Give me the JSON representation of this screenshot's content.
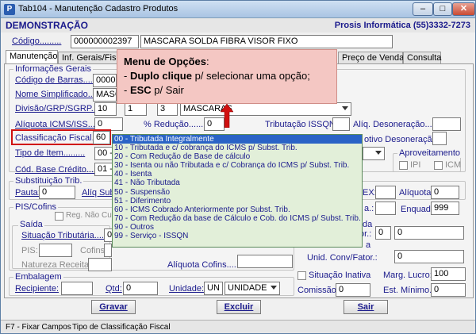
{
  "window": {
    "title": "Tab104 - Manutenção Cadastro Produtos",
    "app_icon": "P"
  },
  "header": {
    "company_mode": "DEMONSTRAÇÃO",
    "company_contact": "Prosis Informática (55)3332-7273"
  },
  "product": {
    "code_label": "Código.........",
    "code": "000000002397",
    "description": "MASCARA SOLDA FIBRA VISOR FIXO"
  },
  "tabs": [
    "Manutenção",
    "Inf. Gerais/Fiscais",
    "Preço de Venda",
    "Consulta"
  ],
  "tooltip": {
    "title": "Menu de Opções",
    "colon": ":",
    "line1_bold": "Duplo clique",
    "line1_rest": " p/ selecionar uma opção;",
    "line2_bold": "ESC",
    "line2_rest": " p/ Sair"
  },
  "general": {
    "section": "Informações Gerais",
    "barcode_label": "Código de Barras......",
    "barcode_value": "00000",
    "short_name_label": "Nome Simplificado.....",
    "short_name_value": "MASC",
    "division_label": "Divisão/GRP/SGRP..:",
    "division": "10",
    "group": "1",
    "subgroup": "3",
    "subgroup_name": "MASCARAS",
    "icms_label": "Alíquota ICMS/ISS......",
    "icms_value": "0",
    "reduction_label": "% Redução.........",
    "reduction_value": "0",
    "issqn_label": "Tributação ISSQN:",
    "desoneracao_label": "Alíq. Desoneração...:",
    "class_label": "Classificação Fiscal..:",
    "class_value": "60",
    "motivo_label": "otivo Desoneração:",
    "item_type_label": "Tipo de Item.........",
    "item_type_value": "00 -",
    "base_code_label": "Cód. Base Crédito......",
    "base_code_value": "01 -",
    "aproveitamento_label": "Aproveitamento",
    "ipi_label": "IPI",
    "icm_label": "ICM"
  },
  "subst": {
    "section": "Substituição Trib.",
    "pauta_label": "Pauta:",
    "pauta_value": "0",
    "aliq_sub_label": "Alíq Sub",
    "ex_label": "EX:",
    "aliquota_label": "Alíquota:",
    "aliquota_value": "0",
    "a_label": "a.:",
    "enquad_label": "Enquad.:",
    "enquad_value": "999"
  },
  "pis": {
    "section": "PIS/Cofins",
    "reg_label": "Reg. Não Cumula",
    "saida": "Saída",
    "sit_label": "Situação Tributária.......",
    "sit_value": "01",
    "pis_label": "PIS:",
    "cofins_label": "Cofins:",
    "natureza_label": "Natureza Receita........",
    "aliq_cofins_label": "Alíquota Cofins.........",
    "or_label": "or.:",
    "or_value": "0",
    "da_label": "da",
    "unid_label": "Unid. Conv/Fator.:",
    "unid_value": "0",
    "a2_label": "a",
    "or2_value": "0"
  },
  "embalagem": {
    "section": "Embalagem",
    "recipiente_label": "Recipiente:",
    "qtd_label": "Qtd:",
    "qtd_value": "0",
    "unidade_label": "Unidade:",
    "unidade_code": "UN",
    "unidade_name": "UNIDADE",
    "situacao_label": "Situação Inativa",
    "marg_label": "Marg. Lucro:",
    "marg_value": "100",
    "comissao_label": "Comissão:",
    "comissao_value": "0",
    "estmin_label": "Est. Mínimo.:",
    "estmin_value": "0"
  },
  "dropdown": [
    "00 - Tributada Integralmente",
    "10 - Tributada e c/ cobrança do ICMS p/ Subst. Trib.",
    "20 - Com Redução de Base de cálculo",
    "30 - Isenta ou não Tributada e c/  Cobrança do ICMS p/ Subst. Trib.",
    "40 - Isenta",
    "41 - Não Tributada",
    "50 - Suspensão",
    "51 - Diferimento",
    "60 - ICMS Cobrado Anteriormente por Subst. Trib.",
    "70 - Com Redução da base de Cálculo e Cob. do ICMS p/ Subst. Trib.",
    "90 - Outros",
    "99 - Serviço - ISSQN"
  ],
  "buttons": {
    "save": "Gravar",
    "delete": "Excluir",
    "exit": "Sair"
  },
  "status": {
    "key": "F7 - Fixar Campos",
    "text": "Tipo de Classificação Fiscal"
  },
  "colors": {
    "accent": "#1a1a8c",
    "tooltip_bg": "#f4c7c3",
    "dropdown_bg": "#e2efd9",
    "highlight": "#2a63c6",
    "arrow": "#d01010"
  }
}
